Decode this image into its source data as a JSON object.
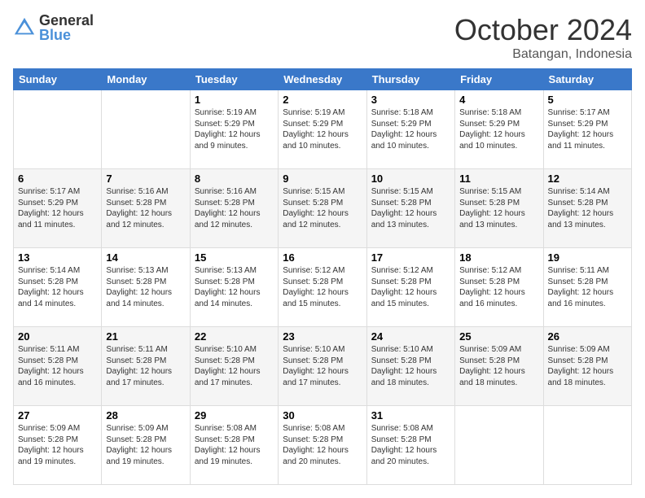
{
  "logo": {
    "general": "General",
    "blue": "Blue"
  },
  "header": {
    "month": "October 2024",
    "location": "Batangan, Indonesia"
  },
  "days": [
    "Sunday",
    "Monday",
    "Tuesday",
    "Wednesday",
    "Thursday",
    "Friday",
    "Saturday"
  ],
  "weeks": [
    [
      {
        "day": "",
        "sunrise": "",
        "sunset": "",
        "daylight": ""
      },
      {
        "day": "",
        "sunrise": "",
        "sunset": "",
        "daylight": ""
      },
      {
        "day": "1",
        "sunrise": "Sunrise: 5:19 AM",
        "sunset": "Sunset: 5:29 PM",
        "daylight": "Daylight: 12 hours and 9 minutes."
      },
      {
        "day": "2",
        "sunrise": "Sunrise: 5:19 AM",
        "sunset": "Sunset: 5:29 PM",
        "daylight": "Daylight: 12 hours and 10 minutes."
      },
      {
        "day": "3",
        "sunrise": "Sunrise: 5:18 AM",
        "sunset": "Sunset: 5:29 PM",
        "daylight": "Daylight: 12 hours and 10 minutes."
      },
      {
        "day": "4",
        "sunrise": "Sunrise: 5:18 AM",
        "sunset": "Sunset: 5:29 PM",
        "daylight": "Daylight: 12 hours and 10 minutes."
      },
      {
        "day": "5",
        "sunrise": "Sunrise: 5:17 AM",
        "sunset": "Sunset: 5:29 PM",
        "daylight": "Daylight: 12 hours and 11 minutes."
      }
    ],
    [
      {
        "day": "6",
        "sunrise": "Sunrise: 5:17 AM",
        "sunset": "Sunset: 5:29 PM",
        "daylight": "Daylight: 12 hours and 11 minutes."
      },
      {
        "day": "7",
        "sunrise": "Sunrise: 5:16 AM",
        "sunset": "Sunset: 5:28 PM",
        "daylight": "Daylight: 12 hours and 12 minutes."
      },
      {
        "day": "8",
        "sunrise": "Sunrise: 5:16 AM",
        "sunset": "Sunset: 5:28 PM",
        "daylight": "Daylight: 12 hours and 12 minutes."
      },
      {
        "day": "9",
        "sunrise": "Sunrise: 5:15 AM",
        "sunset": "Sunset: 5:28 PM",
        "daylight": "Daylight: 12 hours and 12 minutes."
      },
      {
        "day": "10",
        "sunrise": "Sunrise: 5:15 AM",
        "sunset": "Sunset: 5:28 PM",
        "daylight": "Daylight: 12 hours and 13 minutes."
      },
      {
        "day": "11",
        "sunrise": "Sunrise: 5:15 AM",
        "sunset": "Sunset: 5:28 PM",
        "daylight": "Daylight: 12 hours and 13 minutes."
      },
      {
        "day": "12",
        "sunrise": "Sunrise: 5:14 AM",
        "sunset": "Sunset: 5:28 PM",
        "daylight": "Daylight: 12 hours and 13 minutes."
      }
    ],
    [
      {
        "day": "13",
        "sunrise": "Sunrise: 5:14 AM",
        "sunset": "Sunset: 5:28 PM",
        "daylight": "Daylight: 12 hours and 14 minutes."
      },
      {
        "day": "14",
        "sunrise": "Sunrise: 5:13 AM",
        "sunset": "Sunset: 5:28 PM",
        "daylight": "Daylight: 12 hours and 14 minutes."
      },
      {
        "day": "15",
        "sunrise": "Sunrise: 5:13 AM",
        "sunset": "Sunset: 5:28 PM",
        "daylight": "Daylight: 12 hours and 14 minutes."
      },
      {
        "day": "16",
        "sunrise": "Sunrise: 5:12 AM",
        "sunset": "Sunset: 5:28 PM",
        "daylight": "Daylight: 12 hours and 15 minutes."
      },
      {
        "day": "17",
        "sunrise": "Sunrise: 5:12 AM",
        "sunset": "Sunset: 5:28 PM",
        "daylight": "Daylight: 12 hours and 15 minutes."
      },
      {
        "day": "18",
        "sunrise": "Sunrise: 5:12 AM",
        "sunset": "Sunset: 5:28 PM",
        "daylight": "Daylight: 12 hours and 16 minutes."
      },
      {
        "day": "19",
        "sunrise": "Sunrise: 5:11 AM",
        "sunset": "Sunset: 5:28 PM",
        "daylight": "Daylight: 12 hours and 16 minutes."
      }
    ],
    [
      {
        "day": "20",
        "sunrise": "Sunrise: 5:11 AM",
        "sunset": "Sunset: 5:28 PM",
        "daylight": "Daylight: 12 hours and 16 minutes."
      },
      {
        "day": "21",
        "sunrise": "Sunrise: 5:11 AM",
        "sunset": "Sunset: 5:28 PM",
        "daylight": "Daylight: 12 hours and 17 minutes."
      },
      {
        "day": "22",
        "sunrise": "Sunrise: 5:10 AM",
        "sunset": "Sunset: 5:28 PM",
        "daylight": "Daylight: 12 hours and 17 minutes."
      },
      {
        "day": "23",
        "sunrise": "Sunrise: 5:10 AM",
        "sunset": "Sunset: 5:28 PM",
        "daylight": "Daylight: 12 hours and 17 minutes."
      },
      {
        "day": "24",
        "sunrise": "Sunrise: 5:10 AM",
        "sunset": "Sunset: 5:28 PM",
        "daylight": "Daylight: 12 hours and 18 minutes."
      },
      {
        "day": "25",
        "sunrise": "Sunrise: 5:09 AM",
        "sunset": "Sunset: 5:28 PM",
        "daylight": "Daylight: 12 hours and 18 minutes."
      },
      {
        "day": "26",
        "sunrise": "Sunrise: 5:09 AM",
        "sunset": "Sunset: 5:28 PM",
        "daylight": "Daylight: 12 hours and 18 minutes."
      }
    ],
    [
      {
        "day": "27",
        "sunrise": "Sunrise: 5:09 AM",
        "sunset": "Sunset: 5:28 PM",
        "daylight": "Daylight: 12 hours and 19 minutes."
      },
      {
        "day": "28",
        "sunrise": "Sunrise: 5:09 AM",
        "sunset": "Sunset: 5:28 PM",
        "daylight": "Daylight: 12 hours and 19 minutes."
      },
      {
        "day": "29",
        "sunrise": "Sunrise: 5:08 AM",
        "sunset": "Sunset: 5:28 PM",
        "daylight": "Daylight: 12 hours and 19 minutes."
      },
      {
        "day": "30",
        "sunrise": "Sunrise: 5:08 AM",
        "sunset": "Sunset: 5:28 PM",
        "daylight": "Daylight: 12 hours and 20 minutes."
      },
      {
        "day": "31",
        "sunrise": "Sunrise: 5:08 AM",
        "sunset": "Sunset: 5:28 PM",
        "daylight": "Daylight: 12 hours and 20 minutes."
      },
      {
        "day": "",
        "sunrise": "",
        "sunset": "",
        "daylight": ""
      },
      {
        "day": "",
        "sunrise": "",
        "sunset": "",
        "daylight": ""
      }
    ]
  ]
}
